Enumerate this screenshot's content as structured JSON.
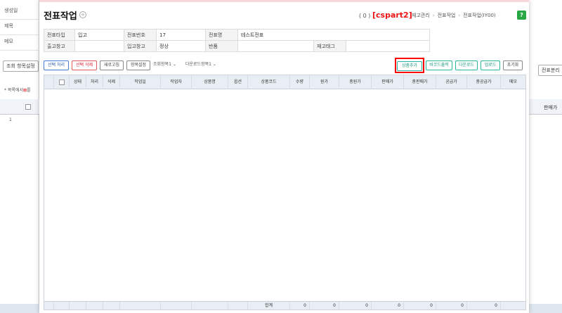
{
  "background": {
    "left_rows": [
      "생성일",
      "제목",
      "메모"
    ],
    "query_settings_btn": "조회 항목설정",
    "note_prefix": "* 목록에서",
    "note_mark": "⊠",
    "note_suffix": "를",
    "row_number": "1",
    "right_col_header": "판매가",
    "right_btn": "전표분리"
  },
  "modal": {
    "title": "전표작업",
    "badge_count": "( 0 )",
    "badge_code": "[cspart2]",
    "breadcrumbs": [
      "재고관리",
      "전표작업",
      "전표작업(IY00)"
    ],
    "help_label": "?"
  },
  "info": {
    "row1": [
      {
        "k": "전표타입",
        "v": "입고"
      },
      {
        "k": "전표번호",
        "v": "17"
      },
      {
        "k": "전표명",
        "v": "테스트전표"
      }
    ],
    "row2": [
      {
        "k": "출고창고",
        "v": ""
      },
      {
        "k": "입고창고",
        "v": "정상"
      },
      {
        "k": "반품",
        "v": ""
      },
      {
        "k": "재고태그",
        "v": ""
      }
    ]
  },
  "toolbar": {
    "select_process": "선택 처리",
    "select_delete": "선택 삭제",
    "refresh": "새로고침",
    "item_settings": "항목설정",
    "query_items": "조회항목1",
    "download_items": "다운로드항목1",
    "add_product": "상품추가",
    "barcode_print": "바코드출력",
    "download": "다운로드",
    "upload": "업로드",
    "reset": "초기화"
  },
  "grid": {
    "columns": [
      "상태",
      "처리",
      "삭제",
      "작업일",
      "작업자",
      "상품명",
      "옵션",
      "상품코드",
      "수량",
      "원가",
      "총원가",
      "판매가",
      "총판매가",
      "공급가",
      "총공급가",
      "메모"
    ],
    "footer": {
      "label": "합계",
      "values": [
        "0",
        "0",
        "0",
        "0",
        "0",
        "0",
        "0"
      ]
    }
  }
}
